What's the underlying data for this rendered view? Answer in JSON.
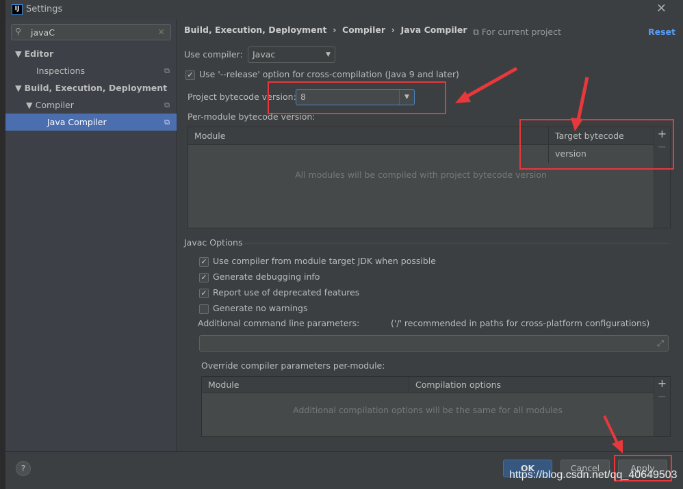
{
  "window": {
    "title": "Settings",
    "app_icon": "IJ",
    "close_icon": "close-icon"
  },
  "sidebar": {
    "search_value": "javaC",
    "items": [
      {
        "label": "Editor"
      },
      {
        "label": "Inspections"
      },
      {
        "label": "Build, Execution, Deployment"
      },
      {
        "label": "Compiler"
      },
      {
        "label": "Java Compiler"
      }
    ]
  },
  "breadcrumb": [
    "Build, Execution, Deployment",
    "Compiler",
    "Java Compiler"
  ],
  "scope": "For current project",
  "reset": "Reset",
  "use_compiler": {
    "label": "Use compiler:",
    "value": "Javac"
  },
  "release_option": {
    "label": "Use '--release' option for cross-compilation (Java 9 and later)",
    "checked": true
  },
  "bytecode": {
    "label": "Project bytecode version:",
    "value": "8"
  },
  "per_module": {
    "label": "Per-module bytecode version:",
    "columns": [
      "Module",
      "Target bytecode version"
    ],
    "empty": "All modules will be compiled with project bytecode version"
  },
  "javac": {
    "section": "Javac Options",
    "options": [
      {
        "label": "Use compiler from module target JDK when possible",
        "checked": true
      },
      {
        "label": "Generate debugging info",
        "checked": true
      },
      {
        "label": "Report use of deprecated features",
        "checked": true
      },
      {
        "label": "Generate no warnings",
        "checked": false
      }
    ],
    "params_label": "Additional command line parameters:",
    "params_hint": "('/' recommended in paths for cross-platform configurations)",
    "params_value": "",
    "override_label": "Override compiler parameters per-module:",
    "override_columns": [
      "Module",
      "Compilation options"
    ],
    "override_empty": "Additional compilation options will be the same for all modules"
  },
  "footer": {
    "help": "?",
    "ok": "OK",
    "cancel": "Cancel",
    "apply": "Apply"
  },
  "watermark": "https://blog.csdn.net/qq_40649503",
  "colors": {
    "selection": "#4b6eaf",
    "accent_link": "#589df6",
    "annotation": "#e8383b"
  }
}
